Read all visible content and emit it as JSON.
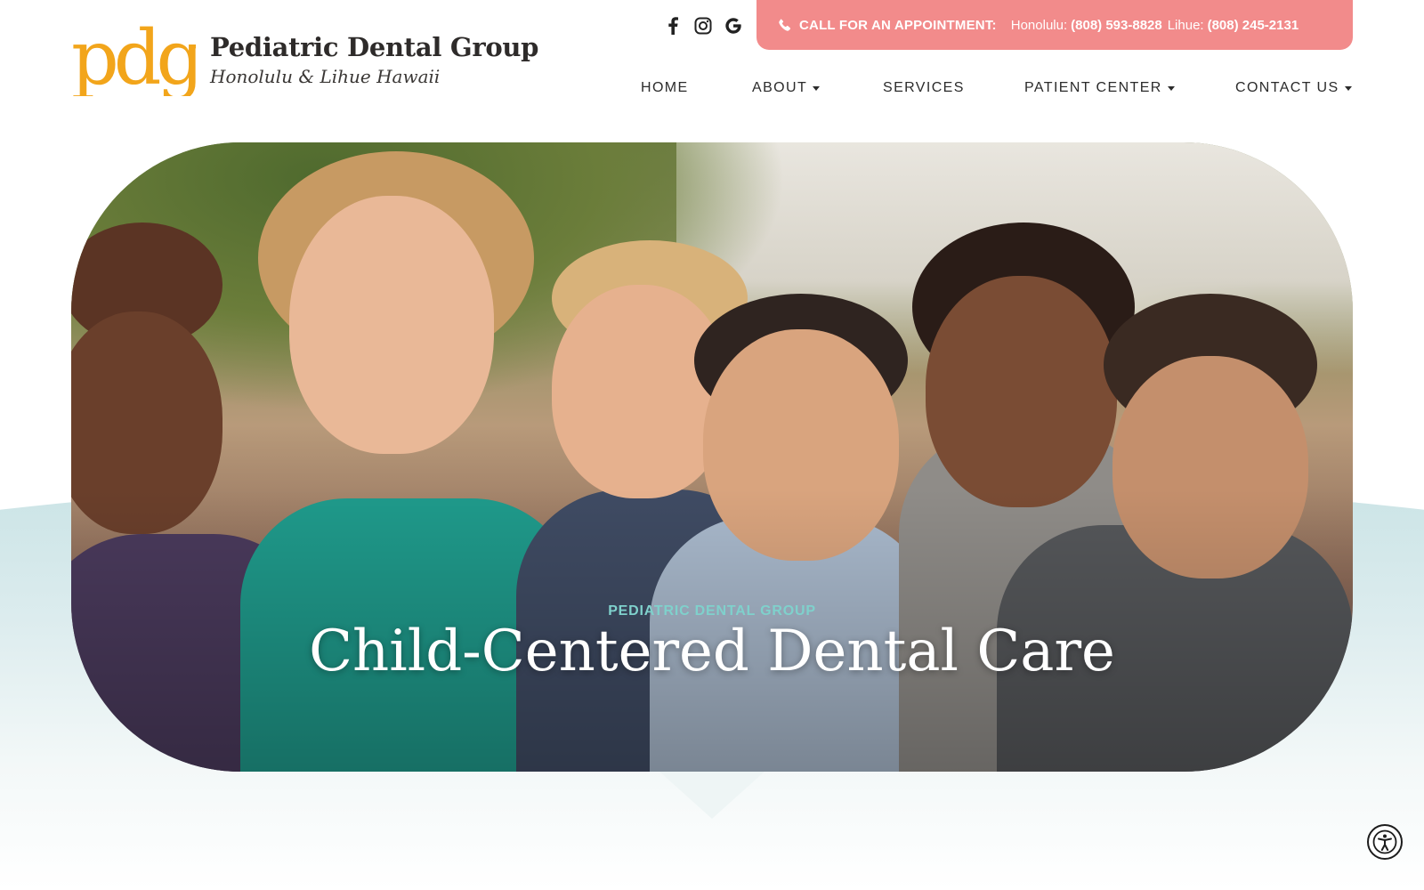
{
  "brand": {
    "logo_text": "pdg",
    "name": "Pediatric Dental Group",
    "tagline": "Honolulu & Lihue Hawaii",
    "logo_color": "#f2a51b"
  },
  "socials": [
    {
      "icon": "facebook-icon"
    },
    {
      "icon": "instagram-icon"
    },
    {
      "icon": "google-icon"
    }
  ],
  "appointment": {
    "label": "CALL FOR AN APPOINTMENT:",
    "honolulu_label": "Honolulu:",
    "honolulu_phone": "(808) 593-8828",
    "lihue_label": "Lihue:",
    "lihue_phone": "(808) 245-2131",
    "bg_color": "#f28b8b"
  },
  "nav": {
    "items": [
      {
        "label": "HOME",
        "dropdown": false
      },
      {
        "label": "ABOUT",
        "dropdown": true
      },
      {
        "label": "SERVICES",
        "dropdown": false
      },
      {
        "label": "PATIENT CENTER",
        "dropdown": true
      },
      {
        "label": "CONTACT US",
        "dropdown": true
      }
    ]
  },
  "hero": {
    "eyebrow": "PEDIATRIC DENTAL GROUP",
    "title": "Child-Centered Dental Care",
    "eyebrow_color": "#7fd1cc"
  },
  "accessibility": {
    "icon": "accessibility-icon"
  }
}
